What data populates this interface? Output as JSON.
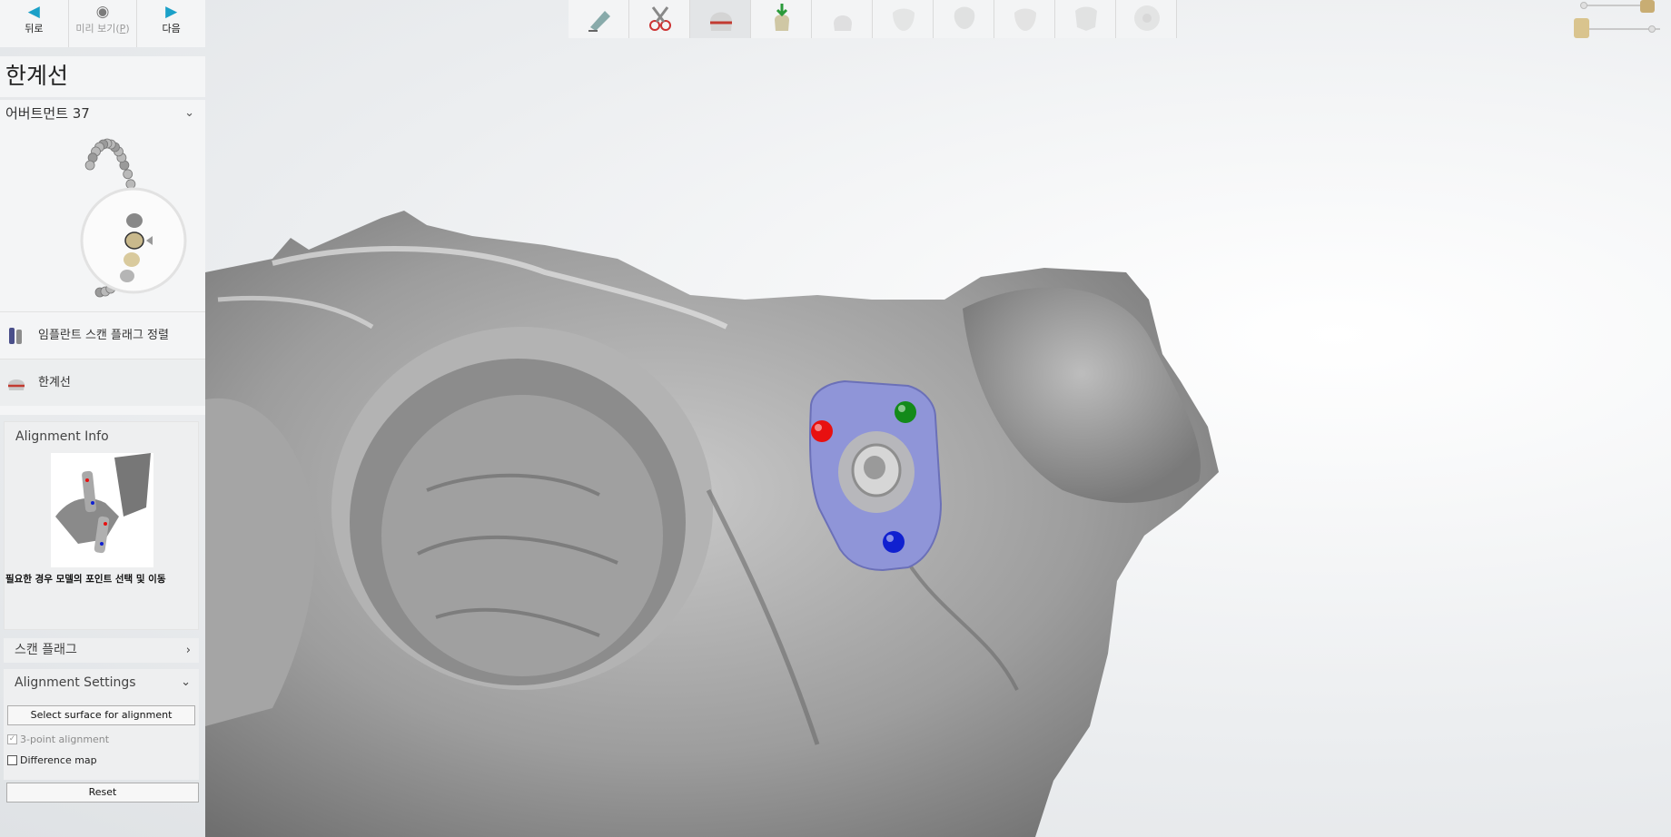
{
  "nav": {
    "back_label": "뒤로",
    "preview_label": "미리 보기(",
    "preview_key": "P",
    "preview_close": ")",
    "next_label": "다음"
  },
  "stage_title": "한계선",
  "abutment": {
    "label": "어버트먼트 37"
  },
  "workflow_steps": [
    {
      "label": "임플란트 스캔 플래그 정렬",
      "icon": "scan-flag-icon"
    },
    {
      "label": "한계선",
      "icon": "margin-line-icon"
    }
  ],
  "alignment_info": {
    "title": "Alignment Info",
    "caption": "필요한 경우 모델의 포인트 선택 및 이동"
  },
  "scan_flag_section": {
    "title": "스캔 플래그"
  },
  "alignment_settings": {
    "title": "Alignment Settings",
    "select_surface_label": "Select surface for alignment",
    "three_point_label": "3-point alignment",
    "three_point_checked": true,
    "three_point_enabled": false,
    "difference_map_label": "Difference map",
    "difference_map_checked": false,
    "reset_label": "Reset"
  },
  "toolbar": {
    "tools": [
      {
        "icon": "scan-tool-icon",
        "state": "done"
      },
      {
        "icon": "cut-scissors-icon",
        "state": "done"
      },
      {
        "icon": "margin-line-icon",
        "state": "active"
      },
      {
        "icon": "insertion-direction-icon",
        "state": "done"
      },
      {
        "icon": "abutment-icon",
        "state": "disabled"
      },
      {
        "icon": "tooth-crown-icon",
        "state": "disabled"
      },
      {
        "icon": "anatomy-icon",
        "state": "disabled"
      },
      {
        "icon": "crown-shape-icon",
        "state": "disabled"
      },
      {
        "icon": "crown-design-icon",
        "state": "disabled"
      },
      {
        "icon": "disc-icon",
        "state": "disabled"
      }
    ]
  },
  "alignment_points": [
    {
      "color": "#e81010"
    },
    {
      "color": "#138a1a"
    },
    {
      "color": "#1020d0"
    }
  ],
  "colors": {
    "accent": "#1aa0c8",
    "panel_bg": "#f4f5f6",
    "flag_overlay": "#8f95d8"
  }
}
